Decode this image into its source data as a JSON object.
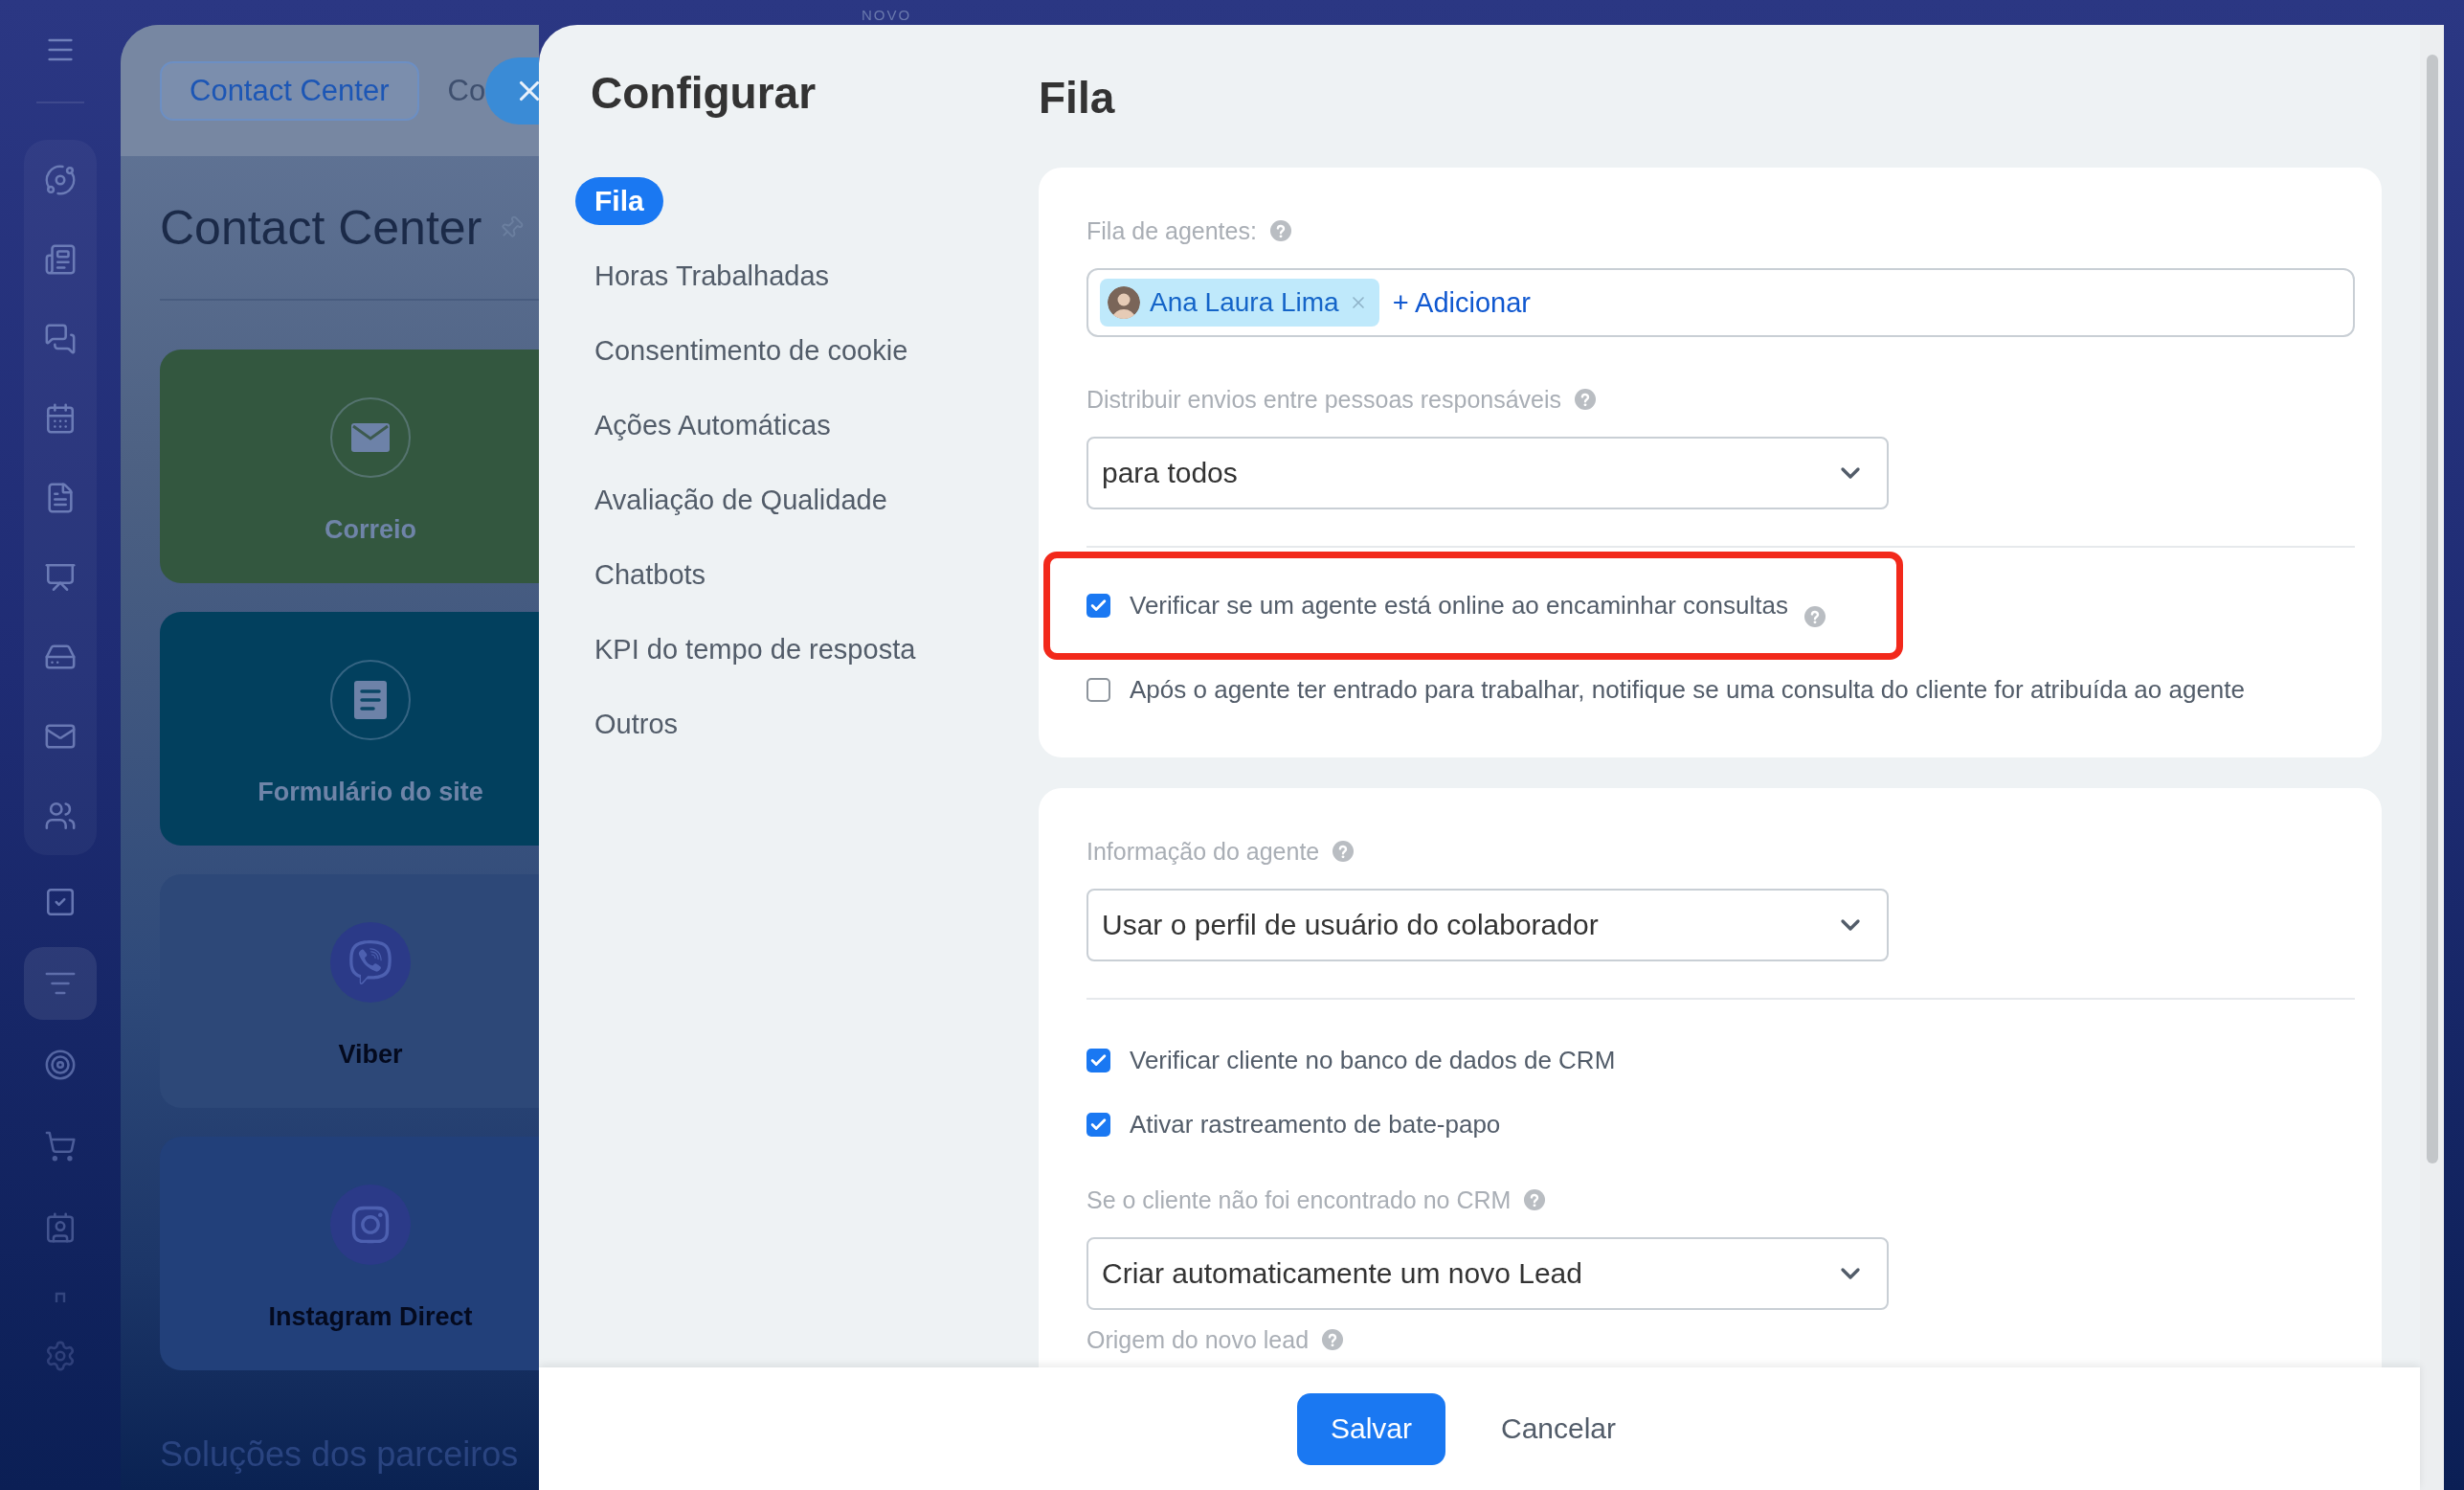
{
  "top_bar": {
    "badge": "NOVO"
  },
  "sidebar": {
    "items": [
      {
        "selected": false
      },
      {
        "selected": false
      },
      {
        "selected": false
      },
      {
        "selected": false
      },
      {
        "selected": false
      },
      {
        "selected": false
      },
      {
        "selected": false
      },
      {
        "selected": false
      },
      {
        "selected": false
      },
      {
        "selected": false
      },
      {
        "selected": true
      },
      {
        "selected": false
      },
      {
        "selected": false
      },
      {
        "selected": false
      },
      {
        "selected": false
      },
      {
        "selected": false
      }
    ]
  },
  "background_page": {
    "tabs": [
      {
        "label": "Contact Center",
        "selected": true
      },
      {
        "label": "Co",
        "selected": false
      }
    ],
    "title": "Contact Center",
    "channels": [
      {
        "label": "Correio",
        "kind": "connected",
        "color": "#33573f"
      },
      {
        "label": "Formulário do site",
        "kind": "connected",
        "color": "#02405e"
      },
      {
        "label": "Viber",
        "kind": "available"
      },
      {
        "label": "Instagram Direct",
        "kind": "available"
      }
    ],
    "section_title": "Soluções dos parceiros"
  },
  "settings": {
    "title": "Configurar",
    "nav": [
      {
        "label": "Fila",
        "selected": true
      },
      {
        "label": "Horas Trabalhadas",
        "selected": false
      },
      {
        "label": "Consentimento de cookie",
        "selected": false
      },
      {
        "label": "Ações Automáticas",
        "selected": false
      },
      {
        "label": "Avaliação de Qualidade",
        "selected": false
      },
      {
        "label": "Chatbots",
        "selected": false
      },
      {
        "label": "KPI do tempo de resposta",
        "selected": false
      },
      {
        "label": "Outros",
        "selected": false
      }
    ],
    "page_title": "Fila",
    "sections": [
      {
        "fields": [
          {
            "kind": "tags",
            "label": "Fila de agentes:",
            "help": true,
            "tags": [
              {
                "name": "Ana Laura Lima"
              }
            ],
            "add_label": "+ Adicionar"
          },
          {
            "kind": "select",
            "label": "Distribuir envios entre pessoas responsáveis",
            "help": true,
            "value": "para todos"
          },
          {
            "kind": "divider"
          },
          {
            "kind": "checkbox",
            "label": "Verificar se um agente está online ao encaminhar consultas",
            "help": true,
            "checked": true,
            "highlighted": true
          },
          {
            "kind": "checkbox",
            "label": "Após o agente ter entrado para trabalhar, notifique se uma consulta do cliente for atribuída ao agente",
            "help": false,
            "checked": false,
            "highlighted": false
          }
        ]
      },
      {
        "fields": [
          {
            "kind": "select",
            "label": "Informação do agente",
            "help": true,
            "value": "Usar o perfil de usuário do colaborador"
          },
          {
            "kind": "divider"
          },
          {
            "kind": "checkbox",
            "label": "Verificar cliente no banco de dados de CRM",
            "help": false,
            "checked": true,
            "highlighted": false
          },
          {
            "kind": "checkbox",
            "label": "Ativar rastreamento de bate-papo",
            "help": false,
            "checked": true,
            "highlighted": false
          },
          {
            "kind": "select",
            "label": "Se o cliente não foi encontrado no CRM",
            "help": true,
            "value": "Criar automaticamente um novo Lead"
          },
          {
            "kind": "label",
            "label": "Origem do novo lead",
            "help": true
          }
        ]
      }
    ],
    "actions": [
      {
        "label": "Salvar",
        "kind": "primary"
      },
      {
        "label": "Cancelar",
        "kind": "secondary"
      }
    ]
  }
}
